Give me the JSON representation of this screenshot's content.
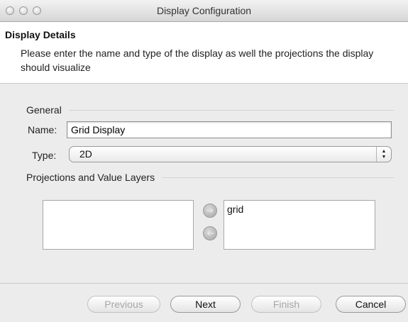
{
  "window": {
    "title": "Display Configuration"
  },
  "header": {
    "title": "Display Details",
    "description": "Please enter the name and type of the display as well the projections the display should visualize"
  },
  "general": {
    "group_label": "General",
    "name_label": "Name:",
    "name_value": "Grid Display",
    "type_label": "Type:",
    "type_value": "2D"
  },
  "projections": {
    "group_label": "Projections and Value Layers",
    "left_items": [],
    "right_items": [
      "grid"
    ]
  },
  "buttons": {
    "previous": "Previous",
    "next": "Next",
    "finish": "Finish",
    "cancel": "Cancel"
  },
  "colors": {
    "header_bg": "#ffffff",
    "window_bg": "#ececec"
  }
}
